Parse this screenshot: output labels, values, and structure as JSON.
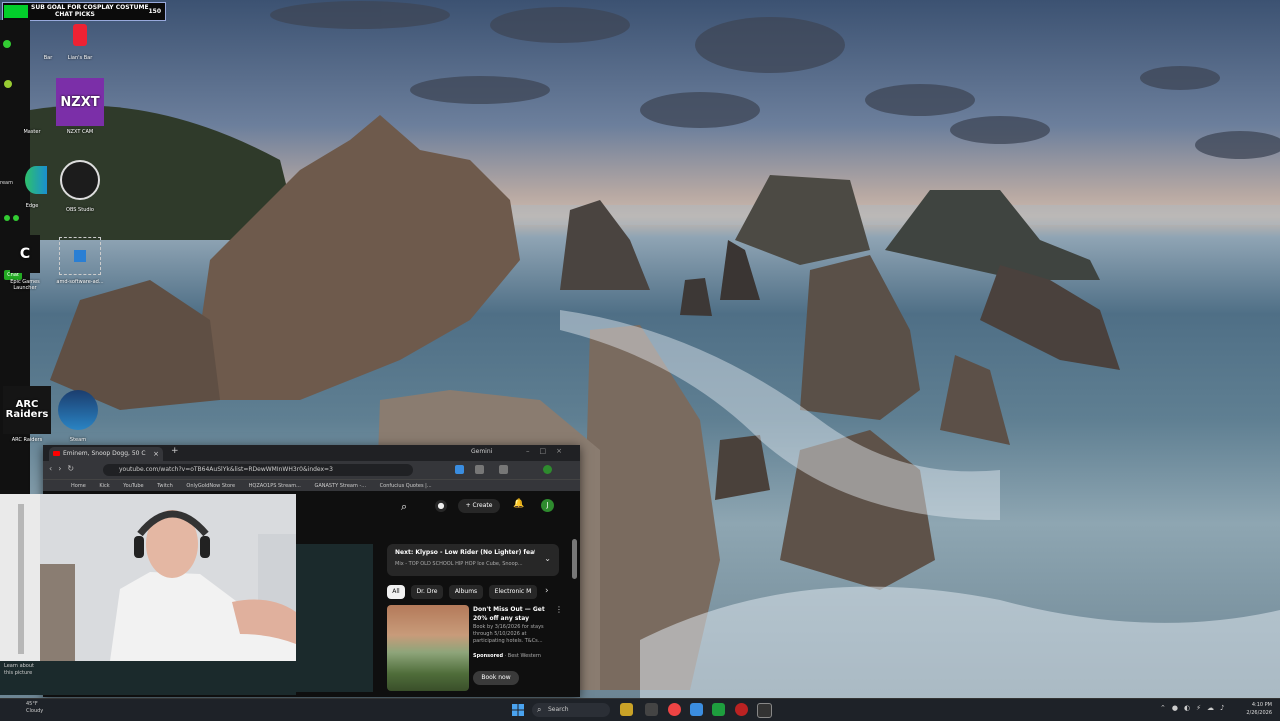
{
  "overlay": {
    "line1": "SUB GOAL FOR COSPLAY COSTUME",
    "line2": "CHAT PICKS",
    "count": "150"
  },
  "stream_panel": {
    "chat_label": "Chat",
    "stream_label": "ream",
    "learn_text": "Learn about this picture"
  },
  "desktop_icons": [
    {
      "label": "Bar",
      "icon": "app-icon"
    },
    {
      "label": "Lian's Bar",
      "icon": "app-icon"
    },
    {
      "label": "Master",
      "icon": "app-icon"
    },
    {
      "label": "NZXT CAM",
      "icon": "nzxt-icon"
    },
    {
      "label": "Edge",
      "icon": "edge-icon"
    },
    {
      "label": "OBS Studio",
      "icon": "obs-icon"
    },
    {
      "label": "Epic Games Launcher",
      "icon": "epic-icon"
    },
    {
      "label": "amd-software-ad...",
      "icon": "installer-icon"
    },
    {
      "label": "ARC Raiders",
      "icon": "arc-raiders-icon"
    },
    {
      "label": "Steam",
      "icon": "steam-icon"
    }
  ],
  "browser": {
    "tab_title": "Eminem, Snoop Dogg, 50 C",
    "gemini_label": "Gemini",
    "url": "youtube.com/watch?v=oTB64AuSlYk&list=RDewWMInWH3r0&index=3",
    "bookmarks": [
      "Home",
      "Kick",
      "YouTube",
      "Twitch",
      "OnlyGoldNow Store",
      "HQZAO1PS Stream...",
      "GANASTY Stream -...",
      "Confucius Quotes |..."
    ]
  },
  "youtube": {
    "create_label": "Create",
    "avatar_letter": "J",
    "next_title": "Next: Klypso - Low Rider (No Lighter) feat. ...",
    "next_sub": "Mix - TOP OLD SCHOOL HIP HOP Ice Cube, Snoop...",
    "chips": [
      "All",
      "Dr. Dre",
      "Albums",
      "Electronic M"
    ],
    "ad": {
      "title": "Don't Miss Out — Get 20% off any stay",
      "desc": "Book by 3/16/2026 for stays through 5/10/2026 at participating hotels. T&Cs...",
      "sponsored": "Sponsored",
      "advertiser": "· Best Western",
      "cta": "Book now"
    }
  },
  "taskbar": {
    "temp": "45°F",
    "condition": "Cloudy",
    "search_placeholder": "Search",
    "time": "4:10 PM",
    "date": "2/26/2026"
  }
}
